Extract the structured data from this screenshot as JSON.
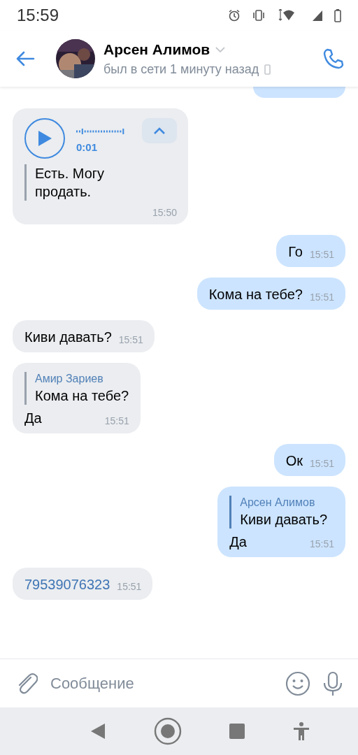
{
  "status_bar": {
    "time": "15:59"
  },
  "header": {
    "name": "Арсен Алимов",
    "status": "был в сети 1 минуту назад"
  },
  "messages": [
    {
      "kind": "voice",
      "outgoing": false,
      "duration": "0:01",
      "transcript": "Есть. Могу продать.",
      "time": "15:50"
    },
    {
      "kind": "text",
      "outgoing": true,
      "text": "Го",
      "time": "15:51"
    },
    {
      "kind": "text",
      "outgoing": true,
      "text": "Кома на тебе?",
      "time": "15:51"
    },
    {
      "kind": "text",
      "outgoing": false,
      "text": "Киви давать?",
      "time": "15:51"
    },
    {
      "kind": "reply",
      "outgoing": false,
      "quote_author": "Амир Зариев",
      "quote_text": "Кома на тебе?",
      "text": "Да",
      "time": "15:51"
    },
    {
      "kind": "text",
      "outgoing": true,
      "text": "Ок",
      "time": "15:51"
    },
    {
      "kind": "reply",
      "outgoing": true,
      "quote_author": "Арсен Алимов",
      "quote_text": "Киви давать?",
      "text": "Да",
      "time": "15:51"
    },
    {
      "kind": "link",
      "outgoing": false,
      "text": "79539076323",
      "time": "15:51"
    }
  ],
  "composer": {
    "placeholder": "Сообщение"
  }
}
